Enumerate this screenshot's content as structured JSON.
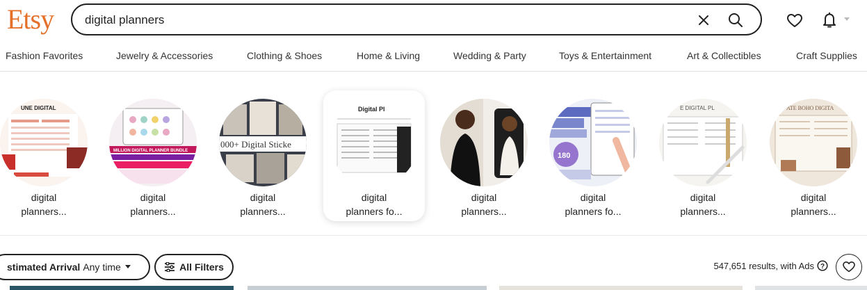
{
  "logo": "Etsy",
  "search": {
    "value": "digital planners"
  },
  "icons": {
    "clear": "close-icon",
    "search": "search-icon",
    "favorites": "heart-icon",
    "notifications": "bell-icon",
    "info": "info-icon"
  },
  "nav": {
    "items": [
      "Fashion Favorites",
      "Jewelry & Accessories",
      "Clothing & Shoes",
      "Home & Living",
      "Wedding & Party",
      "Toys & Entertainment",
      "Art & Collectibles",
      "Craft Supplies"
    ]
  },
  "categories": [
    {
      "line1": "digital",
      "line2": "planners...",
      "image_text": "UNE DIGITAL"
    },
    {
      "line1": "digital",
      "line2": "planners...",
      "image_text": "MILLION DIGITAL PLANNER BUNDLE"
    },
    {
      "line1": "digital",
      "line2": "planners...",
      "image_text": "000+ Digital Sticke"
    },
    {
      "line1": "digital",
      "line2": "planners fo...",
      "image_text": "Digital Pl"
    },
    {
      "line1": "digital",
      "line2": "planners...",
      "image_text": ""
    },
    {
      "line1": "digital",
      "line2": "planners fo...",
      "image_text": "180"
    },
    {
      "line1": "digital",
      "line2": "planners...",
      "image_text": "E DIGITAL PL"
    },
    {
      "line1": "digital",
      "line2": "planners...",
      "image_text": "ATE BOHO DIGITA"
    }
  ],
  "filters": {
    "arrival_label": "stimated Arrival",
    "arrival_value": "Any time",
    "all_filters": "All Filters"
  },
  "results": {
    "text": "547,651 results, with Ads"
  },
  "colors": {
    "brand": "#e4702a",
    "text": "#222222"
  }
}
